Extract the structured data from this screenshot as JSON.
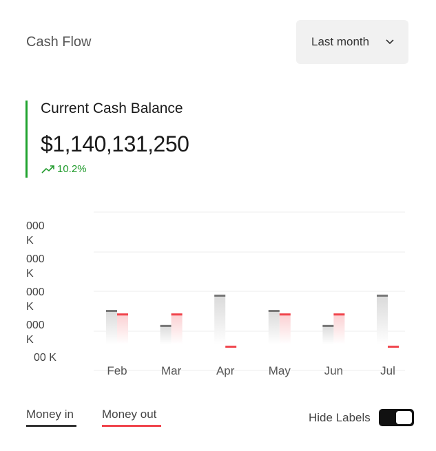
{
  "header": {
    "title": "Cash Flow",
    "period_label": "Last month"
  },
  "balance": {
    "title": "Current Cash Balance",
    "amount": "$1,140,131,250",
    "change": "10.2%"
  },
  "chart_data": {
    "type": "bar",
    "categories": [
      "Feb",
      "Mar",
      "Apr",
      "May",
      "Jun",
      "Jul"
    ],
    "series": [
      {
        "name": "Money in",
        "values": [
          3.06,
          2.3,
          3.83,
          3.06,
          2.3,
          3.83
        ],
        "color": "#777777"
      },
      {
        "name": "Money out",
        "values": [
          2.88,
          2.88,
          1.25,
          2.88,
          2.88,
          1.25
        ],
        "color": "#f0444c"
      }
    ],
    "ylim": [
      0,
      8
    ],
    "y_ticks": [
      "000\nK",
      "000\nK",
      "000\nK",
      "000\nK",
      "00 K"
    ],
    "grid": true
  },
  "legend": {
    "money_in": "Money in",
    "money_out": "Money out",
    "money_in_color": "#333333",
    "money_out_color": "#f0444c"
  },
  "controls": {
    "hide_labels": "Hide Labels",
    "hide_labels_on": true
  }
}
